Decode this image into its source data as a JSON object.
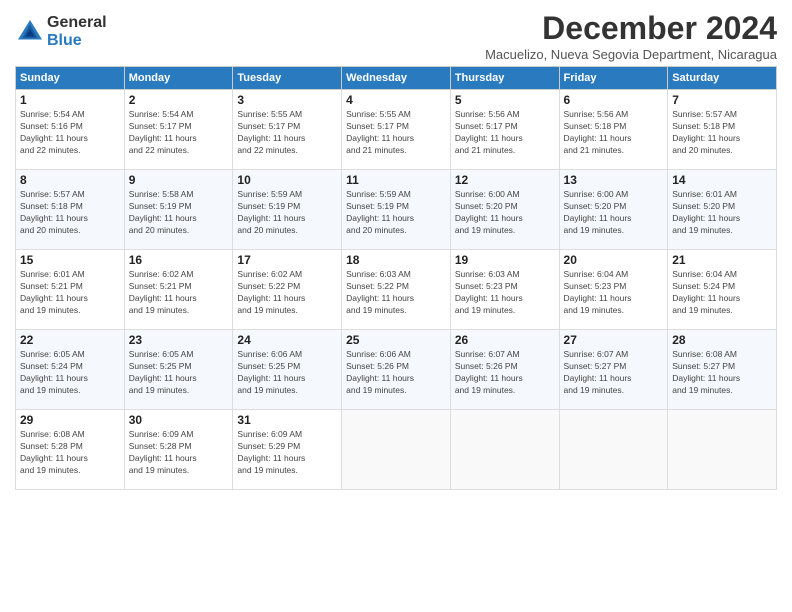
{
  "header": {
    "logo_general": "General",
    "logo_blue": "Blue",
    "month_title": "December 2024",
    "subtitle": "Macuelizo, Nueva Segovia Department, Nicaragua"
  },
  "weekdays": [
    "Sunday",
    "Monday",
    "Tuesday",
    "Wednesday",
    "Thursday",
    "Friday",
    "Saturday"
  ],
  "weeks": [
    [
      {
        "day": "1",
        "info": "Sunrise: 5:54 AM\nSunset: 5:16 PM\nDaylight: 11 hours\nand 22 minutes."
      },
      {
        "day": "2",
        "info": "Sunrise: 5:54 AM\nSunset: 5:17 PM\nDaylight: 11 hours\nand 22 minutes."
      },
      {
        "day": "3",
        "info": "Sunrise: 5:55 AM\nSunset: 5:17 PM\nDaylight: 11 hours\nand 22 minutes."
      },
      {
        "day": "4",
        "info": "Sunrise: 5:55 AM\nSunset: 5:17 PM\nDaylight: 11 hours\nand 21 minutes."
      },
      {
        "day": "5",
        "info": "Sunrise: 5:56 AM\nSunset: 5:17 PM\nDaylight: 11 hours\nand 21 minutes."
      },
      {
        "day": "6",
        "info": "Sunrise: 5:56 AM\nSunset: 5:18 PM\nDaylight: 11 hours\nand 21 minutes."
      },
      {
        "day": "7",
        "info": "Sunrise: 5:57 AM\nSunset: 5:18 PM\nDaylight: 11 hours\nand 20 minutes."
      }
    ],
    [
      {
        "day": "8",
        "info": "Sunrise: 5:57 AM\nSunset: 5:18 PM\nDaylight: 11 hours\nand 20 minutes."
      },
      {
        "day": "9",
        "info": "Sunrise: 5:58 AM\nSunset: 5:19 PM\nDaylight: 11 hours\nand 20 minutes."
      },
      {
        "day": "10",
        "info": "Sunrise: 5:59 AM\nSunset: 5:19 PM\nDaylight: 11 hours\nand 20 minutes."
      },
      {
        "day": "11",
        "info": "Sunrise: 5:59 AM\nSunset: 5:19 PM\nDaylight: 11 hours\nand 20 minutes."
      },
      {
        "day": "12",
        "info": "Sunrise: 6:00 AM\nSunset: 5:20 PM\nDaylight: 11 hours\nand 19 minutes."
      },
      {
        "day": "13",
        "info": "Sunrise: 6:00 AM\nSunset: 5:20 PM\nDaylight: 11 hours\nand 19 minutes."
      },
      {
        "day": "14",
        "info": "Sunrise: 6:01 AM\nSunset: 5:20 PM\nDaylight: 11 hours\nand 19 minutes."
      }
    ],
    [
      {
        "day": "15",
        "info": "Sunrise: 6:01 AM\nSunset: 5:21 PM\nDaylight: 11 hours\nand 19 minutes."
      },
      {
        "day": "16",
        "info": "Sunrise: 6:02 AM\nSunset: 5:21 PM\nDaylight: 11 hours\nand 19 minutes."
      },
      {
        "day": "17",
        "info": "Sunrise: 6:02 AM\nSunset: 5:22 PM\nDaylight: 11 hours\nand 19 minutes."
      },
      {
        "day": "18",
        "info": "Sunrise: 6:03 AM\nSunset: 5:22 PM\nDaylight: 11 hours\nand 19 minutes."
      },
      {
        "day": "19",
        "info": "Sunrise: 6:03 AM\nSunset: 5:23 PM\nDaylight: 11 hours\nand 19 minutes."
      },
      {
        "day": "20",
        "info": "Sunrise: 6:04 AM\nSunset: 5:23 PM\nDaylight: 11 hours\nand 19 minutes."
      },
      {
        "day": "21",
        "info": "Sunrise: 6:04 AM\nSunset: 5:24 PM\nDaylight: 11 hours\nand 19 minutes."
      }
    ],
    [
      {
        "day": "22",
        "info": "Sunrise: 6:05 AM\nSunset: 5:24 PM\nDaylight: 11 hours\nand 19 minutes."
      },
      {
        "day": "23",
        "info": "Sunrise: 6:05 AM\nSunset: 5:25 PM\nDaylight: 11 hours\nand 19 minutes."
      },
      {
        "day": "24",
        "info": "Sunrise: 6:06 AM\nSunset: 5:25 PM\nDaylight: 11 hours\nand 19 minutes."
      },
      {
        "day": "25",
        "info": "Sunrise: 6:06 AM\nSunset: 5:26 PM\nDaylight: 11 hours\nand 19 minutes."
      },
      {
        "day": "26",
        "info": "Sunrise: 6:07 AM\nSunset: 5:26 PM\nDaylight: 11 hours\nand 19 minutes."
      },
      {
        "day": "27",
        "info": "Sunrise: 6:07 AM\nSunset: 5:27 PM\nDaylight: 11 hours\nand 19 minutes."
      },
      {
        "day": "28",
        "info": "Sunrise: 6:08 AM\nSunset: 5:27 PM\nDaylight: 11 hours\nand 19 minutes."
      }
    ],
    [
      {
        "day": "29",
        "info": "Sunrise: 6:08 AM\nSunset: 5:28 PM\nDaylight: 11 hours\nand 19 minutes."
      },
      {
        "day": "30",
        "info": "Sunrise: 6:09 AM\nSunset: 5:28 PM\nDaylight: 11 hours\nand 19 minutes."
      },
      {
        "day": "31",
        "info": "Sunrise: 6:09 AM\nSunset: 5:29 PM\nDaylight: 11 hours\nand 19 minutes."
      },
      {
        "day": "",
        "info": ""
      },
      {
        "day": "",
        "info": ""
      },
      {
        "day": "",
        "info": ""
      },
      {
        "day": "",
        "info": ""
      }
    ]
  ]
}
